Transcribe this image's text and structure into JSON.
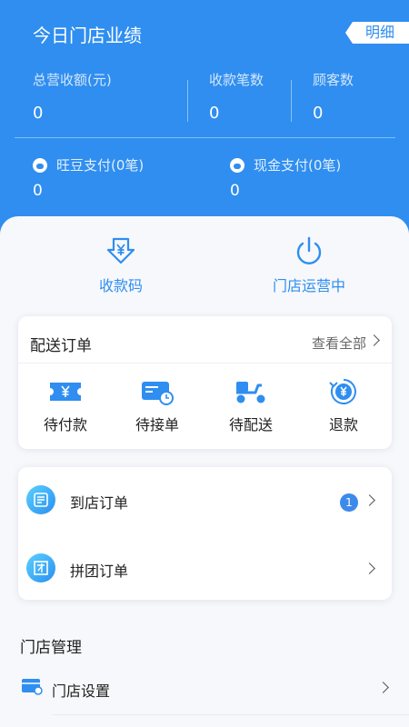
{
  "header": {
    "title": "今日门店业绩",
    "detail_label": "明细",
    "stats": [
      {
        "label": "总营收额(元)",
        "value": "0"
      },
      {
        "label": "收款笔数",
        "value": "0"
      },
      {
        "label": "顾客数",
        "value": "0"
      }
    ],
    "payments": [
      {
        "label": "旺豆支付(0笔)",
        "value": "0",
        "icon": "bean-icon"
      },
      {
        "label": "现金支付(0笔)",
        "value": "0",
        "icon": "money-bag-icon"
      }
    ]
  },
  "quick_actions": [
    {
      "label": "收款码",
      "icon": "receive-code-icon"
    },
    {
      "label": "门店运营中",
      "icon": "power-icon"
    }
  ],
  "delivery": {
    "title": "配送订单",
    "view_all": "查看全部",
    "items": [
      {
        "label": "待付款",
        "icon": "ticket-yuan-icon"
      },
      {
        "label": "待接单",
        "icon": "card-clock-icon"
      },
      {
        "label": "待配送",
        "icon": "scooter-icon"
      },
      {
        "label": "退款",
        "icon": "refund-icon"
      }
    ]
  },
  "orders": [
    {
      "label": "到店订单",
      "badge": "1",
      "icon": "store-order-icon"
    },
    {
      "label": "拼团订单",
      "icon": "group-order-icon"
    }
  ],
  "management": {
    "title": "门店管理",
    "items": [
      {
        "label": "门店设置",
        "icon": "store-settings-icon"
      }
    ]
  },
  "colors": {
    "primary": "#2f8ef0",
    "badge": "#3d8aea"
  }
}
